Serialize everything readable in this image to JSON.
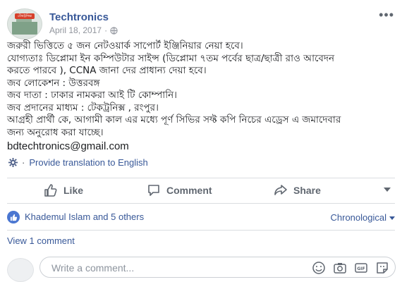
{
  "post": {
    "page_name": "Techtronics",
    "date": "April 18, 2017",
    "separator": "·",
    "avatar_badge": "টেকট্রনিক্স",
    "body_lines": [
      "জরুরী ভিত্তিতে ৫ জন নেটওয়ার্ক সাপোর্ট ইঞ্জিনিয়ার নেয়া হবে।",
      "যোগ্যতাঃ ডিপ্লোমা ইন কম্পিউটার সাইন্স (ডিপ্লোমা ৭তম পর্বের ছাত্র/ছাত্রী রাও আবেদন",
      "করতে পারবে ), CCNA জানা দের প্রাধান্য দেয়া হবে।",
      "জব লোকেশন : উত্তরবঙ্গ",
      "জব দাতা : ঢাকার নামকরা আই টি কোম্পানি।",
      "জব প্রদানের মাধ্যম : টেকট্রনিক্স , রংপুর।",
      "আগ্রহী প্রার্থী কে, আগামী কাল এর মধ্যে পূর্ণ সিভির সফ্ট কপি নিচের এড্রেস এ জমাদেবার",
      "জন্য অনুরোধ করা যাচ্ছে।"
    ],
    "email": "bdtechtronics@gmail.com",
    "translate_label": "Provide translation to English"
  },
  "actions": {
    "like": "Like",
    "comment": "Comment",
    "share": "Share"
  },
  "reactions": {
    "who": "Khademul Islam and 5 others",
    "sort": "Chronological"
  },
  "comments": {
    "view_label": "View 1 comment",
    "placeholder": "Write a comment..."
  },
  "colors": {
    "link": "#385898",
    "muted": "#606770",
    "like_badge": "#4a76d1"
  }
}
